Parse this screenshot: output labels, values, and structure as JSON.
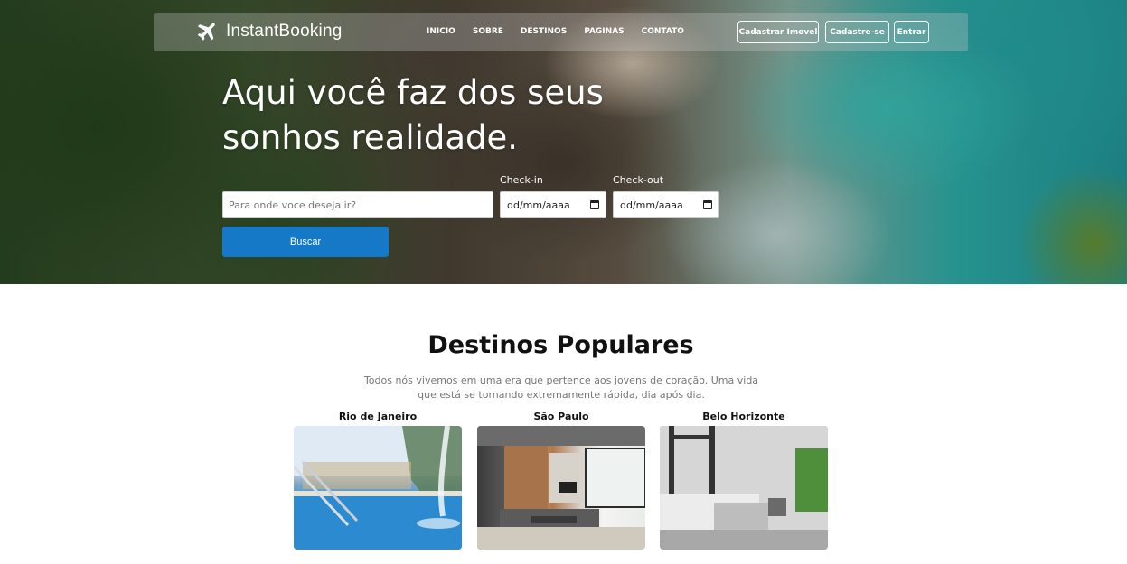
{
  "header": {
    "brand_name": "InstantBooking",
    "menu": [
      "INICIO",
      "SOBRE",
      "DESTINOS",
      "PAGINAS",
      "CONTATO"
    ],
    "buttons": {
      "register_property": "Cadastrar Imovel",
      "sign_up": "Cadastre-se",
      "login": "Entrar"
    }
  },
  "hero": {
    "headline_line1": "Aqui você faz dos seus",
    "headline_line2": "sonhos realidade.",
    "search_placeholder": "Para onde voce deseja ir?",
    "checkin_label": "Check-in",
    "checkout_label": "Check-out",
    "date_placeholder": "dd/mm/aaaa",
    "search_button": "Buscar"
  },
  "destinations": {
    "title": "Destinos Populares",
    "description": "Todos nós vivemos em uma era que pertence aos jovens de coração. Uma vida que está se tornando extremamente rápida, dia após dia.",
    "cards": [
      {
        "name": "Rio de Janeiro"
      },
      {
        "name": "São Paulo"
      },
      {
        "name": "Belo Horizonte"
      }
    ]
  }
}
